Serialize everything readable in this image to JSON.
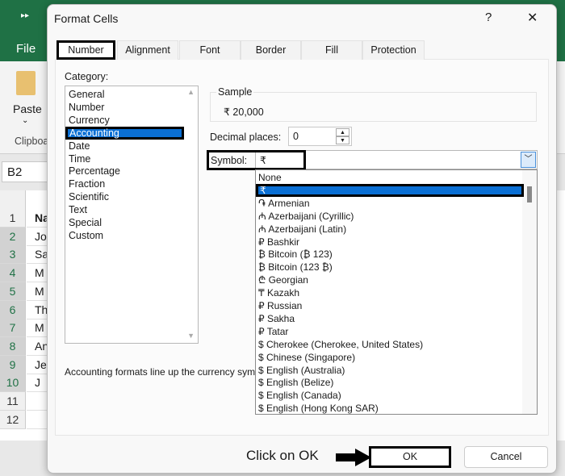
{
  "excel": {
    "ribbon_tab": "File",
    "paste_label": "Paste",
    "clipboard_label": "Clipboa",
    "name_box": "B2",
    "row_numbers": [
      "1",
      "2",
      "3",
      "4",
      "5",
      "6",
      "7",
      "8",
      "9",
      "10",
      "11",
      "12"
    ],
    "col_b_cells": [
      "Na",
      "Jo",
      "Sa",
      "M",
      "M",
      "Th",
      "M",
      "Ant",
      "Je",
      "J",
      "",
      ""
    ]
  },
  "dialog": {
    "title": "Format Cells",
    "help": "?",
    "close": "✕",
    "tabs": [
      "Number",
      "Alignment",
      "Font",
      "Border",
      "Fill",
      "Protection"
    ],
    "category_label": "Category:",
    "categories": [
      "General",
      "Number",
      "Currency",
      "Accounting",
      "Date",
      "Time",
      "Percentage",
      "Fraction",
      "Scientific",
      "Text",
      "Special",
      "Custom"
    ],
    "sample_label": "Sample",
    "sample_value": "₹ 20,000",
    "decimal_label": "Decimal places:",
    "decimal_value": "0",
    "symbol_label": "Symbol:",
    "symbol_value": "₹",
    "symbol_options": [
      "None",
      "₹",
      "֏ Armenian",
      "₼ Azerbaijani (Cyrillic)",
      "₼ Azerbaijani (Latin)",
      "₽ Bashkir",
      "₿ Bitcoin (₿ 123)",
      "₿ Bitcoin (123 ₿)",
      "₾ Georgian",
      "₸ Kazakh",
      "₽ Russian",
      "₽ Sakha",
      "₽ Tatar",
      "$ Cherokee (Cherokee, United States)",
      "$ Chinese (Singapore)",
      "$ English (Australia)",
      "$ English (Belize)",
      "$ English (Canada)",
      "$ English (Hong Kong SAR)"
    ],
    "description": "Accounting formats line up the currency sym",
    "ok": "OK",
    "cancel": "Cancel"
  },
  "annotation": {
    "text": "Click on OK"
  },
  "colors": {
    "excel_green": "#1f7145",
    "selection_blue": "#0a6fd4"
  }
}
